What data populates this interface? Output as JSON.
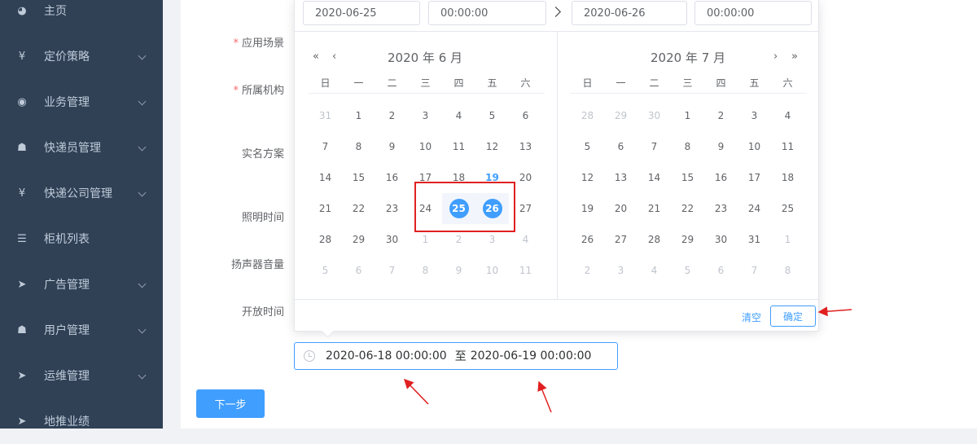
{
  "sidebar": {
    "items": [
      {
        "label": "主页",
        "icon": "dashboard-icon",
        "glyph": "◕",
        "chevron": false
      },
      {
        "label": "定价策略",
        "icon": "yen-icon",
        "glyph": "¥",
        "chevron": true
      },
      {
        "label": "业务管理",
        "icon": "compass-icon",
        "glyph": "◉",
        "chevron": true
      },
      {
        "label": "快递员管理",
        "icon": "courier-icon",
        "glyph": "☗",
        "chevron": true
      },
      {
        "label": "快递公司管理",
        "icon": "yen-icon",
        "glyph": "¥",
        "chevron": true
      },
      {
        "label": "柜机列表",
        "icon": "list-icon",
        "glyph": "☰",
        "chevron": false
      },
      {
        "label": "广告管理",
        "icon": "send-icon",
        "glyph": "➤",
        "chevron": true
      },
      {
        "label": "用户管理",
        "icon": "courier-icon",
        "glyph": "☗",
        "chevron": true
      },
      {
        "label": "运维管理",
        "icon": "send-icon",
        "glyph": "➤",
        "chevron": true
      },
      {
        "label": "地推业绩",
        "icon": "send-icon",
        "glyph": "➤",
        "chevron": false
      }
    ]
  },
  "form": {
    "labels": {
      "app_scene": "应用场景",
      "org": "所属机构",
      "realname": "实名方案",
      "light_time": "照明时间",
      "speaker_volume": "扬声器音量",
      "open_time": "开放时间"
    },
    "required_mark": "*",
    "range": {
      "start": "2020-06-18 00:00:00",
      "separator": "至",
      "end": "2020-06-19 00:00:00"
    },
    "next_button": "下一步"
  },
  "picker": {
    "start_date": "2020-06-25",
    "start_time": "00:00:00",
    "end_date": "2020-06-26",
    "end_time": "00:00:00",
    "left_title": "2020 年 6 月",
    "right_title": "2020 年 7 月",
    "weekdays": [
      "日",
      "一",
      "二",
      "三",
      "四",
      "五",
      "六"
    ],
    "left_days": [
      {
        "d": "31",
        "t": "prev"
      },
      {
        "d": "1"
      },
      {
        "d": "2"
      },
      {
        "d": "3"
      },
      {
        "d": "4"
      },
      {
        "d": "5"
      },
      {
        "d": "6"
      },
      {
        "d": "7"
      },
      {
        "d": "8"
      },
      {
        "d": "9"
      },
      {
        "d": "10"
      },
      {
        "d": "11"
      },
      {
        "d": "12"
      },
      {
        "d": "13"
      },
      {
        "d": "14"
      },
      {
        "d": "15"
      },
      {
        "d": "16"
      },
      {
        "d": "17"
      },
      {
        "d": "18"
      },
      {
        "d": "19",
        "t": "today"
      },
      {
        "d": "20"
      },
      {
        "d": "21"
      },
      {
        "d": "22"
      },
      {
        "d": "23"
      },
      {
        "d": "24"
      },
      {
        "d": "25",
        "t": "sel"
      },
      {
        "d": "26",
        "t": "sel"
      },
      {
        "d": "27"
      },
      {
        "d": "28"
      },
      {
        "d": "29"
      },
      {
        "d": "30"
      },
      {
        "d": "1",
        "t": "next"
      },
      {
        "d": "2",
        "t": "next"
      },
      {
        "d": "3",
        "t": "next"
      },
      {
        "d": "4",
        "t": "next"
      },
      {
        "d": "5",
        "t": "next"
      },
      {
        "d": "6",
        "t": "next"
      },
      {
        "d": "7",
        "t": "next"
      },
      {
        "d": "8",
        "t": "next"
      },
      {
        "d": "9",
        "t": "next"
      },
      {
        "d": "10",
        "t": "next"
      },
      {
        "d": "11",
        "t": "next"
      }
    ],
    "right_days": [
      {
        "d": "28",
        "t": "prev"
      },
      {
        "d": "29",
        "t": "prev"
      },
      {
        "d": "30",
        "t": "prev"
      },
      {
        "d": "1"
      },
      {
        "d": "2"
      },
      {
        "d": "3"
      },
      {
        "d": "4"
      },
      {
        "d": "5"
      },
      {
        "d": "6"
      },
      {
        "d": "7"
      },
      {
        "d": "8"
      },
      {
        "d": "9"
      },
      {
        "d": "10"
      },
      {
        "d": "11"
      },
      {
        "d": "12"
      },
      {
        "d": "13"
      },
      {
        "d": "14"
      },
      {
        "d": "15"
      },
      {
        "d": "16"
      },
      {
        "d": "17"
      },
      {
        "d": "18"
      },
      {
        "d": "19"
      },
      {
        "d": "20"
      },
      {
        "d": "21"
      },
      {
        "d": "22"
      },
      {
        "d": "23"
      },
      {
        "d": "24"
      },
      {
        "d": "25"
      },
      {
        "d": "26"
      },
      {
        "d": "27"
      },
      {
        "d": "28"
      },
      {
        "d": "29"
      },
      {
        "d": "30"
      },
      {
        "d": "31"
      },
      {
        "d": "1",
        "t": "next"
      },
      {
        "d": "2",
        "t": "next"
      },
      {
        "d": "3",
        "t": "next"
      },
      {
        "d": "4",
        "t": "next"
      },
      {
        "d": "5",
        "t": "next"
      },
      {
        "d": "6",
        "t": "next"
      },
      {
        "d": "7",
        "t": "next"
      },
      {
        "d": "8",
        "t": "next"
      }
    ],
    "clear": "清空",
    "confirm": "确定",
    "nav": {
      "prev_year": "«",
      "prev_month": "‹",
      "next_month": "›",
      "next_year": "»"
    }
  },
  "colors": {
    "accent": "#409eff",
    "sidebar_bg": "#304156",
    "annotation": "#e02020"
  }
}
